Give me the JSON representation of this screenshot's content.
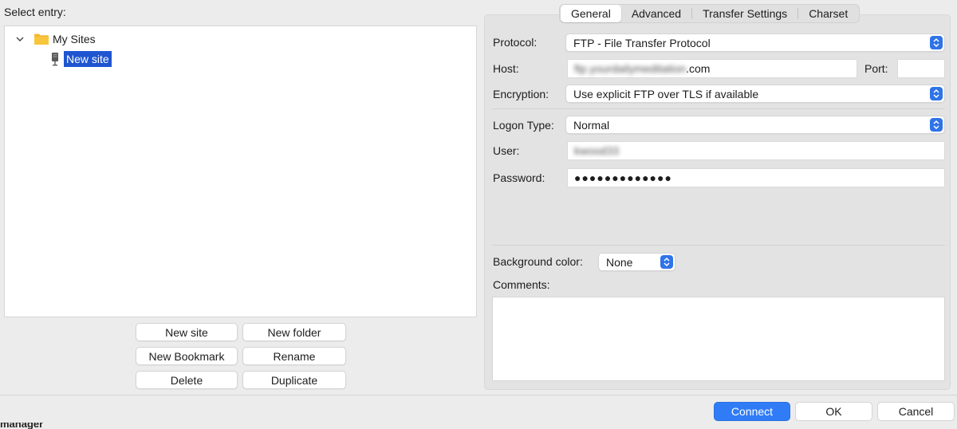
{
  "left": {
    "select_label": "Select entry:",
    "tree": {
      "root_label": "My Sites",
      "child_label": "New site"
    },
    "buttons": {
      "new_site": "New site",
      "new_folder": "New folder",
      "new_bookmark": "New Bookmark",
      "rename": "Rename",
      "delete": "Delete",
      "duplicate": "Duplicate"
    }
  },
  "tabs": [
    "General",
    "Advanced",
    "Transfer Settings",
    "Charset"
  ],
  "active_tab": "General",
  "general": {
    "protocol_label": "Protocol:",
    "protocol_value": "FTP - File Transfer Protocol",
    "host_label": "Host:",
    "host_value_blurred": "ftp.yourdailymeditation",
    "host_value_suffix": ".com",
    "port_label": "Port:",
    "port_value": "",
    "encryption_label": "Encryption:",
    "encryption_value": "Use explicit FTP over TLS if available",
    "logon_label": "Logon Type:",
    "logon_value": "Normal",
    "user_label": "User:",
    "user_value_blurred": "kwood33",
    "password_label": "Password:",
    "password_value": "●●●●●●●●●●●●●",
    "bg_color_label": "Background color:",
    "bg_color_value": "None",
    "comments_label": "Comments:",
    "comments_value": ""
  },
  "footer": {
    "connect": "Connect",
    "ok": "OK",
    "cancel": "Cancel",
    "corner_text": "manager"
  },
  "colors": {
    "selection": "#1f55d0",
    "accent": "#2f7cf6",
    "folder": "#f5b731"
  }
}
